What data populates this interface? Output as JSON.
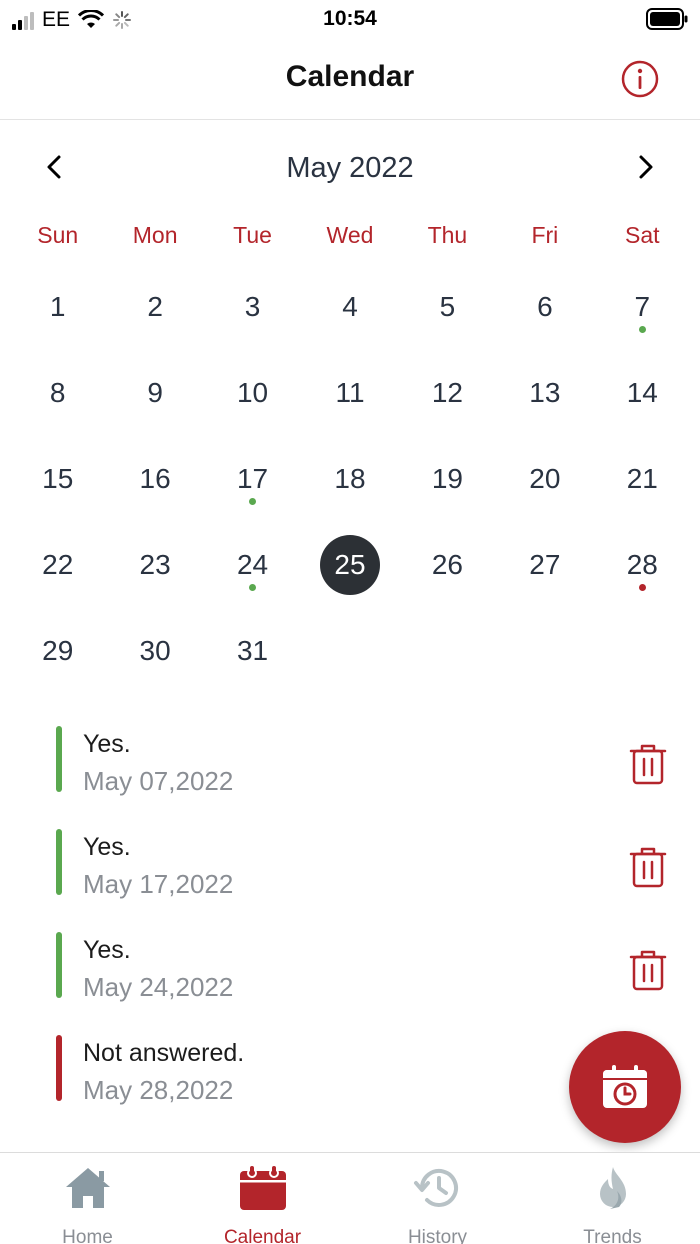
{
  "status_bar": {
    "carrier": "EE",
    "time": "10:54"
  },
  "nav": {
    "title": "Calendar",
    "info_icon": "info-icon"
  },
  "month": {
    "label": "May 2022",
    "prev_icon": "chevron-left-icon",
    "next_icon": "chevron-right-icon"
  },
  "weekdays": [
    "Sun",
    "Mon",
    "Tue",
    "Wed",
    "Thu",
    "Fri",
    "Sat"
  ],
  "days": [
    "1",
    "2",
    "3",
    "4",
    "5",
    "6",
    "7",
    "8",
    "9",
    "10",
    "11",
    "12",
    "13",
    "14",
    "15",
    "16",
    "17",
    "18",
    "19",
    "20",
    "21",
    "22",
    "23",
    "24",
    "25",
    "26",
    "27",
    "28",
    "29",
    "30",
    "31"
  ],
  "selected_day": "25",
  "markers": {
    "7": "#5aa84f",
    "17": "#5aa84f",
    "24": "#5aa84f",
    "28": "#b3252b"
  },
  "entries": [
    {
      "title": "Yes.",
      "date": "May 07,2022",
      "color": "#5aa84f"
    },
    {
      "title": "Yes.",
      "date": "May 17,2022",
      "color": "#5aa84f"
    },
    {
      "title": "Yes.",
      "date": "May 24,2022",
      "color": "#5aa84f"
    },
    {
      "title": "Not answered.",
      "date": "May 28,2022",
      "color": "#b3252b"
    }
  ],
  "fab": {
    "icon": "calendar-clock-icon"
  },
  "tabs": [
    {
      "label": "Home",
      "icon": "home-icon",
      "active": false
    },
    {
      "label": "Calendar",
      "icon": "calendar-icon",
      "active": true
    },
    {
      "label": "History",
      "icon": "history-icon",
      "active": false
    },
    {
      "label": "Trends",
      "icon": "flame-icon",
      "active": false
    }
  ],
  "colors": {
    "accent": "#b3252b",
    "positive": "#5aa84f",
    "selected_day_bg": "#2c3035",
    "inactive": "#8a8e94"
  }
}
